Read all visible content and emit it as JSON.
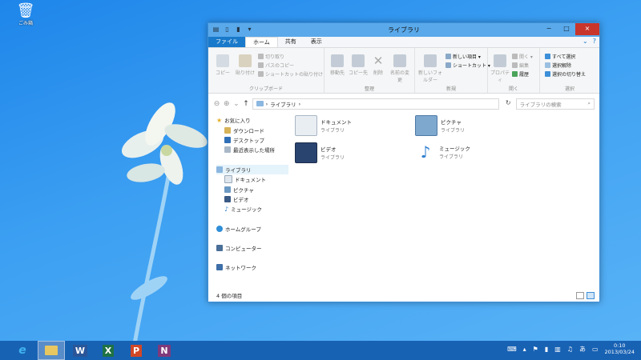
{
  "desktop": {
    "recycle_bin_label": "ごみ箱"
  },
  "window": {
    "title": "ライブラリ",
    "controls": {
      "minimize": "−",
      "maximize": "□",
      "close": "×"
    }
  },
  "tabs": [
    "ファイル",
    "ホーム",
    "共有",
    "表示"
  ],
  "ribbon": {
    "clipboard": {
      "name": "クリップボード",
      "copy": "コピー",
      "paste": "貼り付け",
      "cut": "切り取り",
      "copy_path": "パスのコピー",
      "paste_shortcut": "ショートカットの貼り付け"
    },
    "organize": {
      "name": "整理",
      "move_to": "移動先",
      "copy_to": "コピー先",
      "delete": "削除",
      "rename": "名前の変更"
    },
    "new": {
      "name": "新規",
      "new_folder": "新しいフォルダー",
      "new_item": "新しい項目 ▾",
      "shortcut": "ショートカット ▾"
    },
    "open": {
      "name": "開く",
      "properties": "プロパティ",
      "open": "開く ▾",
      "edit": "編集",
      "history": "履歴"
    },
    "select": {
      "name": "選択",
      "select_all": "すべて選択",
      "select_none": "選択解除",
      "invert": "選択の切り替え"
    }
  },
  "address": {
    "path": "ライブラリ",
    "separator": "›",
    "search_placeholder": "ライブラリの検索"
  },
  "nav": {
    "favorites": "お気に入り",
    "downloads": "ダウンロード",
    "desktop": "デスクトップ",
    "recent": "最近表示した場所",
    "libraries": "ライブラリ",
    "documents": "ドキュメント",
    "pictures": "ピクチャ",
    "videos": "ビデオ",
    "music": "ミュージック",
    "homegroup": "ホームグループ",
    "computer": "コンピューター",
    "network": "ネットワーク"
  },
  "libraries": [
    {
      "name": "ドキュメント",
      "sub": "ライブラリ"
    },
    {
      "name": "ピクチャ",
      "sub": "ライブラリ"
    },
    {
      "name": "ビデオ",
      "sub": "ライブラリ"
    },
    {
      "name": "ミュージック",
      "sub": "ライブラリ"
    }
  ],
  "status": {
    "count": "4 個の項目"
  },
  "taskbar": {
    "apps": [
      "e",
      "",
      "W",
      "X",
      "P",
      "N"
    ],
    "time": "0:10",
    "date": "2013/03/24"
  },
  "colors": {
    "accent": "#1979ca",
    "titlebar": "#5aa9ea",
    "close": "#c7352b"
  }
}
